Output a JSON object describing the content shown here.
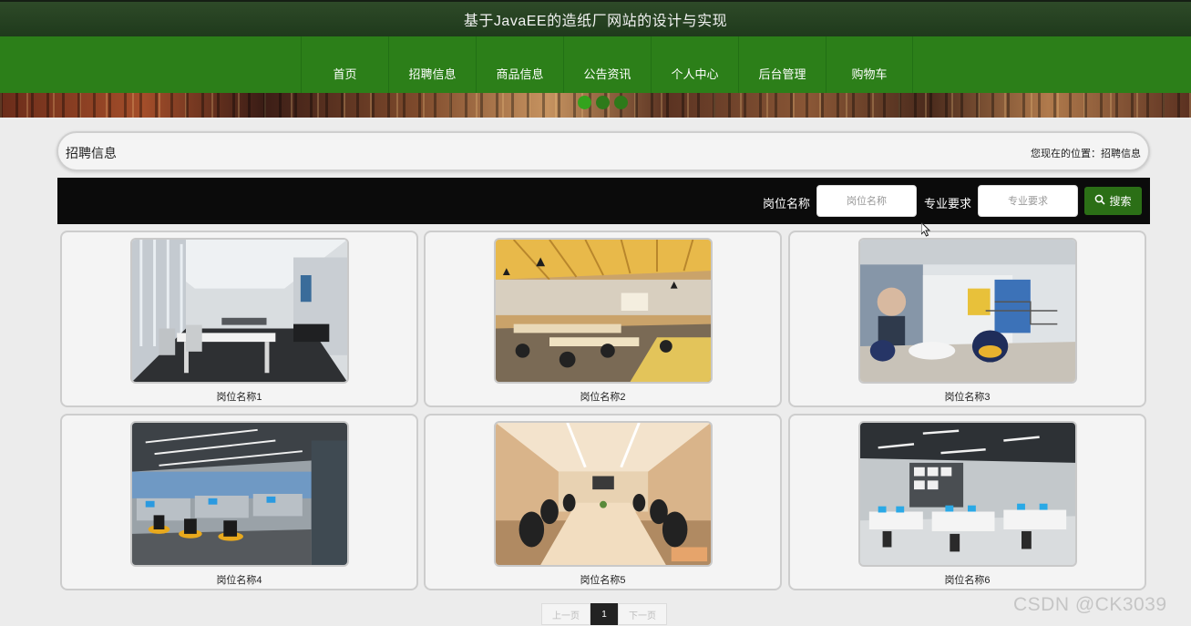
{
  "header": {
    "title": "基于JavaEE的造纸厂网站的设计与实现"
  },
  "nav": {
    "items": [
      {
        "label": "首页"
      },
      {
        "label": "招聘信息"
      },
      {
        "label": "商品信息"
      },
      {
        "label": "公告资讯"
      },
      {
        "label": "个人中心"
      },
      {
        "label": "后台管理"
      },
      {
        "label": "购物车"
      }
    ]
  },
  "banner": {
    "slides": 3,
    "active_slide": 1
  },
  "breadcrumb": {
    "section_title": "招聘信息",
    "location": "您现在的位置：招聘信息"
  },
  "search": {
    "field1_label": "岗位名称",
    "field1_placeholder": "岗位名称",
    "field1_value": "",
    "field2_label": "专业要求",
    "field2_placeholder": "专业要求",
    "field2_value": "",
    "button_label": "搜索",
    "button_icon": "search-icon"
  },
  "jobs": [
    {
      "name": "岗位名称1"
    },
    {
      "name": "岗位名称2"
    },
    {
      "name": "岗位名称3"
    },
    {
      "name": "岗位名称4"
    },
    {
      "name": "岗位名称5"
    },
    {
      "name": "岗位名称6"
    }
  ],
  "pagination": {
    "prev": "上一页",
    "current": "1",
    "next": "下一页"
  },
  "watermark": "CSDN @CK3039",
  "colors": {
    "title_bar": "#2e4a28",
    "nav_bar": "#2c7f19",
    "search_bar": "#0b0b0b",
    "search_button": "#2b6f16"
  }
}
